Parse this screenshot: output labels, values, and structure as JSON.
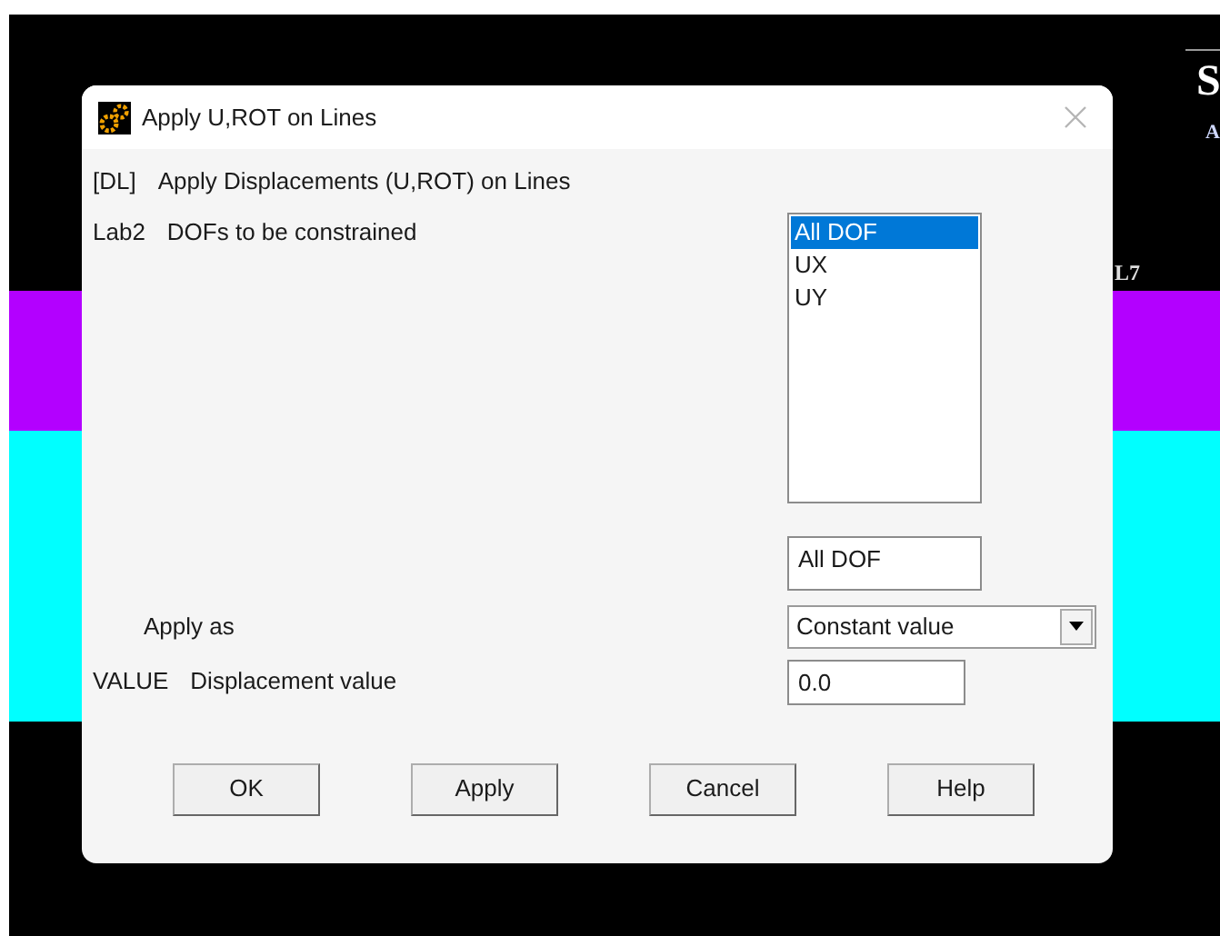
{
  "graphics": {
    "bands": [
      {
        "color": "#b300ff"
      },
      {
        "color": "#00ffff"
      }
    ],
    "labels": [
      {
        "kind": "title",
        "text": "S"
      },
      {
        "kind": "subtitle",
        "text": "A"
      },
      {
        "kind": "line",
        "text": "L7"
      }
    ]
  },
  "dialog": {
    "title": "Apply U,ROT on Lines",
    "heading": {
      "code": "[DL]",
      "text": "Apply Displacements (U,ROT) on Lines"
    },
    "fields": [
      {
        "kind": "listbox",
        "code": "Lab2",
        "label": "DOFs to be constrained",
        "options": [
          {
            "label": "All DOF",
            "selected": true
          },
          {
            "label": "UX",
            "selected": false
          },
          {
            "label": "UY",
            "selected": false
          }
        ],
        "value": "All DOF"
      },
      {
        "kind": "select",
        "label": "Apply as",
        "value": "Constant value"
      },
      {
        "kind": "text",
        "code": "VALUE",
        "label": "Displacement value",
        "value": "0.0"
      }
    ],
    "buttons": [
      "OK",
      "Apply",
      "Cancel",
      "Help"
    ]
  }
}
